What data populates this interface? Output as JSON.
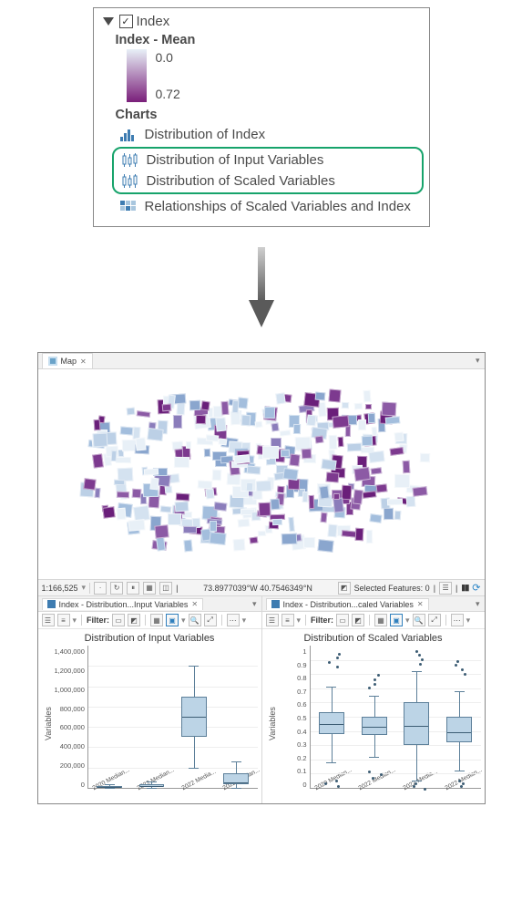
{
  "panel": {
    "layer_name": "Index",
    "subtitle": "Index - Mean",
    "gradient_min": "0.0",
    "gradient_max": "0.72",
    "charts_header": "Charts",
    "items": [
      {
        "icon": "histogram",
        "label": "Distribution of Index"
      },
      {
        "icon": "boxplots",
        "label": "Distribution of Input Variables"
      },
      {
        "icon": "boxplots",
        "label": "Distribution of Scaled Variables"
      },
      {
        "icon": "scatter-matrix",
        "label": "Relationships of Scaled Variables and Index"
      }
    ]
  },
  "map": {
    "tab_label": "Map",
    "scale": "1:166,525",
    "coords": "73.8977039°W 40.7546349°N",
    "selected_features": "Selected Features: 0"
  },
  "chart_left": {
    "tab_label": "Index - Distribution...Input Variables",
    "title": "Distribution of Input Variables",
    "filter_label": "Filter:",
    "ylabel": "Variables",
    "yticks": [
      "1,400,000",
      "1,200,000",
      "1,000,000",
      "800,000",
      "600,000",
      "400,000",
      "200,000",
      "0"
    ],
    "xcats": [
      "2020 Median...",
      "2022 Median...",
      "2022 Media...",
      "2022 Median..."
    ]
  },
  "chart_right": {
    "tab_label": "Index - Distribution...caled Variables",
    "title": "Distribution of Scaled Variables",
    "filter_label": "Filter:",
    "ylabel": "Variables",
    "yticks": [
      "1",
      "0.9",
      "0.8",
      "0.7",
      "0.6",
      "0.5",
      "0.4",
      "0.3",
      "0.2",
      "0.1",
      "0"
    ],
    "xcats": [
      "2020 Median...",
      "2022 Median...",
      "2022 Media...",
      "2022 Median..."
    ]
  },
  "chart_data": [
    {
      "type": "bar",
      "title": "Distribution of Input Variables",
      "ylabel": "Variables",
      "ylim": [
        0,
        1400000
      ],
      "categories": [
        "2020 Median",
        "2022 Median",
        "2022 Media",
        "2022 Median"
      ],
      "series": [
        {
          "name": "q1",
          "values": [
            5000,
            10000,
            500000,
            40000
          ]
        },
        {
          "name": "median",
          "values": [
            10000,
            20000,
            700000,
            80000
          ]
        },
        {
          "name": "q3",
          "values": [
            20000,
            35000,
            900000,
            140000
          ]
        },
        {
          "name": "whisker_low",
          "values": [
            0,
            0,
            200000,
            0
          ]
        },
        {
          "name": "whisker_high",
          "values": [
            40000,
            60000,
            1200000,
            260000
          ]
        }
      ]
    },
    {
      "type": "bar",
      "title": "Distribution of Scaled Variables",
      "ylabel": "Variables",
      "ylim": [
        0,
        1
      ],
      "categories": [
        "2020 Median",
        "2022 Median",
        "2022 Media",
        "2022 Median"
      ],
      "series": [
        {
          "name": "q1",
          "values": [
            0.38,
            0.37,
            0.3,
            0.32
          ]
        },
        {
          "name": "median",
          "values": [
            0.45,
            0.43,
            0.45,
            0.4
          ]
        },
        {
          "name": "q3",
          "values": [
            0.53,
            0.5,
            0.6,
            0.5
          ]
        },
        {
          "name": "whisker_low",
          "values": [
            0.18,
            0.22,
            0.05,
            0.12
          ]
        },
        {
          "name": "whisker_high",
          "values": [
            0.71,
            0.65,
            0.82,
            0.68
          ]
        },
        {
          "name": "outliers_high",
          "values": [
            0.95,
            0.8,
            0.97,
            0.9
          ]
        },
        {
          "name": "outliers_low",
          "values": [
            0.02,
            0.08,
            0.0,
            0.02
          ]
        }
      ]
    }
  ]
}
